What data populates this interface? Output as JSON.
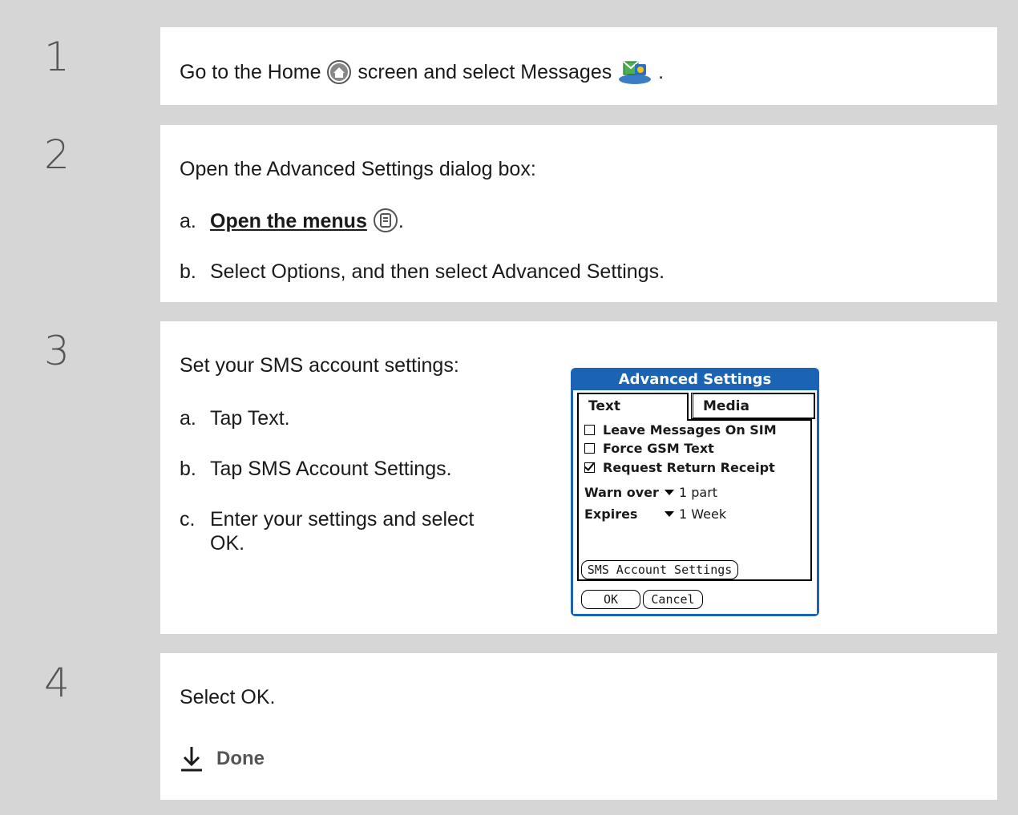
{
  "steps": [
    {
      "number": "1",
      "text_before": "Go to the Home",
      "text_middle": "screen and select Messages",
      "text_after": "."
    },
    {
      "number": "2",
      "intro": "Open the Advanced Settings dialog box:",
      "a_label": "a.",
      "a_link": "Open the menus",
      "a_after": ".",
      "b_label": "b.",
      "b_text": "Select Options, and then select Advanced Settings."
    },
    {
      "number": "3",
      "intro": "Set your SMS account settings:",
      "a_label": "a.",
      "a_text": "Tap Text.",
      "b_label": "b.",
      "b_text": "Tap SMS Account Settings.",
      "c_label": "c.",
      "c_text_1": "Enter your settings and select",
      "c_text_2": "OK."
    },
    {
      "number": "4",
      "text": "Select OK.",
      "done": "Done"
    }
  ],
  "dialog": {
    "title": "Advanced Settings",
    "tab_text": "Text",
    "tab_media": "Media",
    "checkboxes": [
      {
        "label": "Leave Messages On SIM",
        "checked": false
      },
      {
        "label": "Force GSM Text",
        "checked": false
      },
      {
        "label": "Request Return Receipt",
        "checked": true
      }
    ],
    "warn_label": "Warn over",
    "warn_value": "1 part",
    "expires_label": "Expires",
    "expires_value": "1 Week",
    "sms_button": "SMS Account Settings",
    "ok_button": "OK",
    "cancel_button": "Cancel"
  },
  "colors": {
    "dialog_blue": "#1b63b5",
    "background": "#d6d6d6"
  }
}
